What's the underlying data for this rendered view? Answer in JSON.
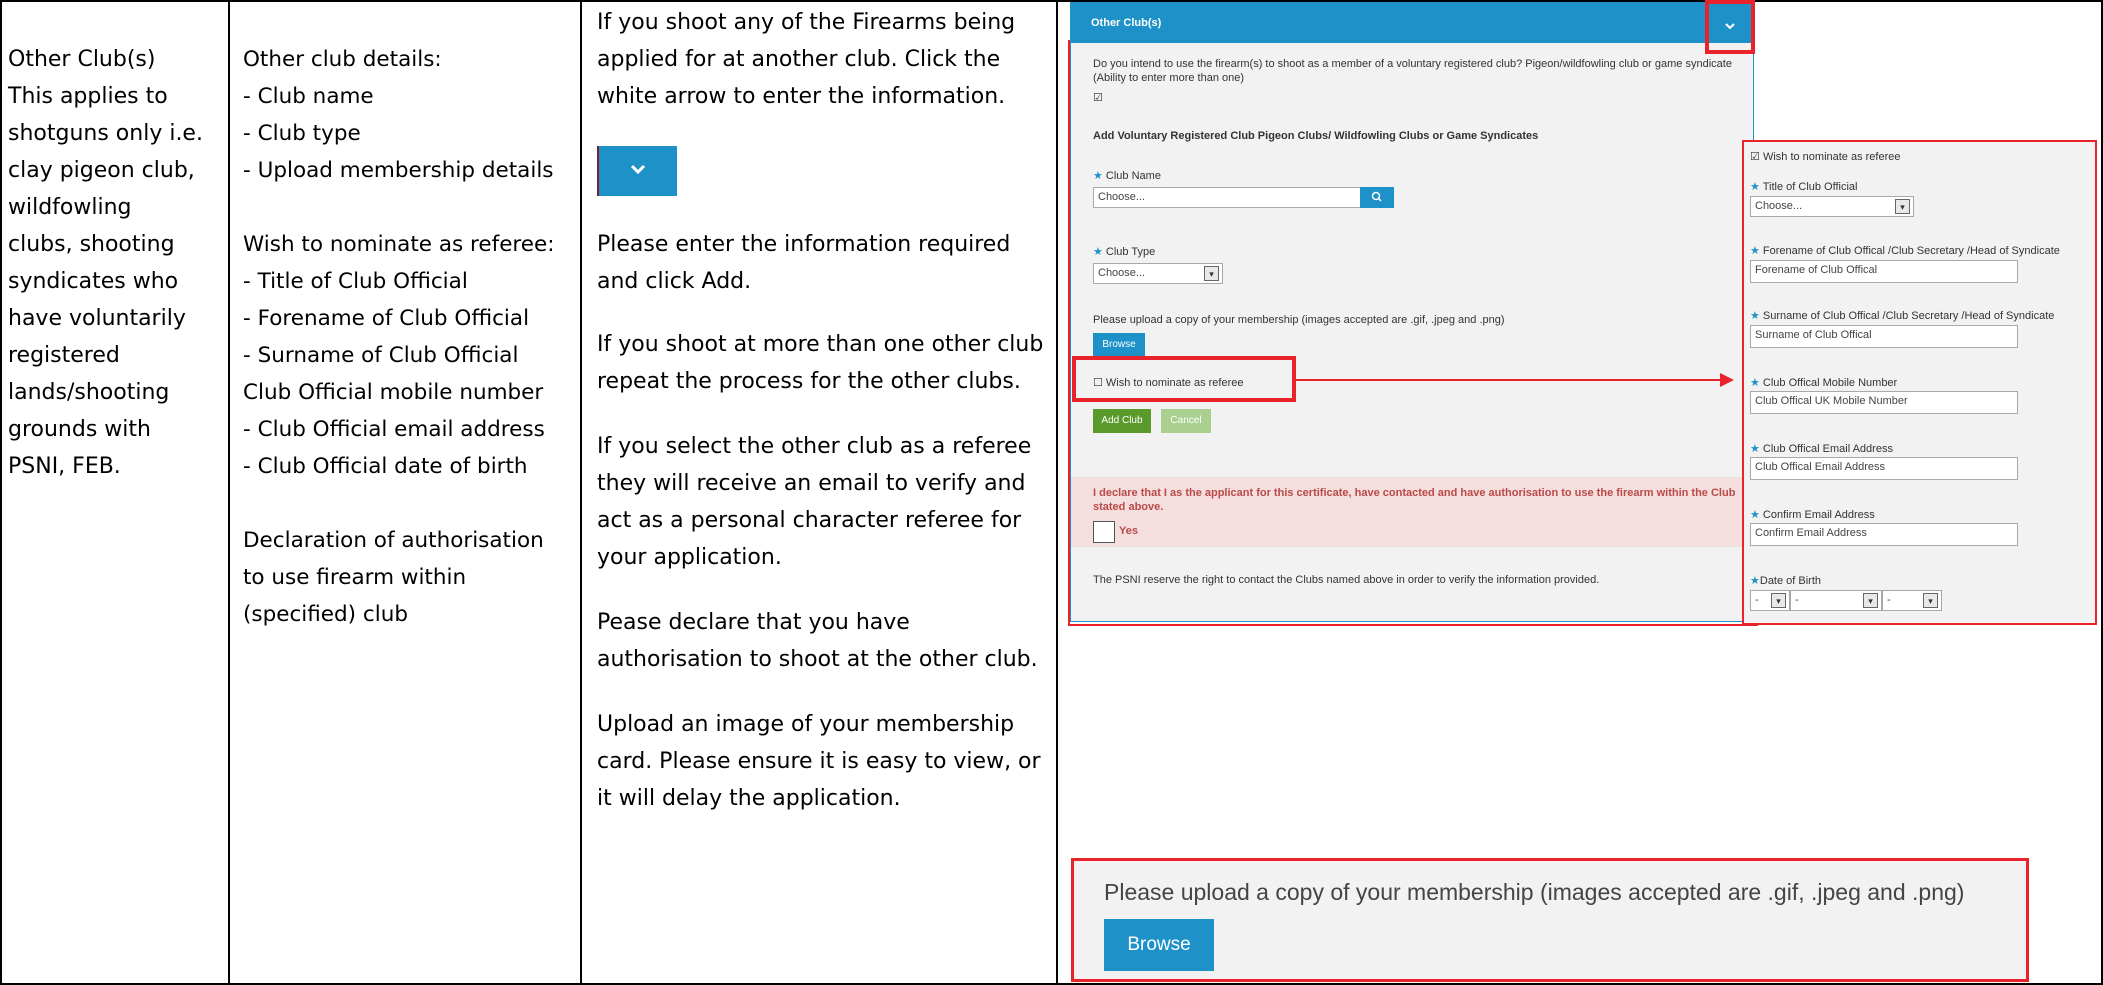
{
  "col1": {
    "lines": [
      "Other Club(s)",
      "This applies to",
      "shotguns only i.e.",
      "clay pigeon club,",
      "wildfowling",
      "clubs, shooting",
      "syndicates who",
      "have voluntarily",
      "registered",
      "lands/shooting",
      "grounds with",
      "PSNI, FEB."
    ]
  },
  "col2": {
    "lines": [
      "Other club details:",
      "- Club name",
      "- Club type",
      "- Upload membership details",
      "",
      "Wish to nominate as referee:",
      "- Title of Club Official",
      "- Forename of Club Official",
      "- Surname of Club Official",
      "Club Official mobile number",
      "- Club Official email address",
      "- Club Official date of birth",
      "",
      "Declaration of authorisation",
      "to use firearm within",
      "(specified) club"
    ]
  },
  "col3": {
    "p1": "If you shoot any of the Firearms being\napplied for at another club. Click the\nwhite arrow to enter the information.",
    "p2": "Please enter the information required\nand click Add.",
    "p3": "If you shoot at more than one other club\nrepeat the process for the other clubs.",
    "p4": "If you select the other club as a referee\nthey will receive an email to verify and\nact as a personal character referee for\nyour application.",
    "p5": "Pease declare that you have\nauthorisation to shoot at the other club.",
    "p6": "Upload an image of your membership\ncard. Please ensure it is easy to view, or\nit will delay the application.",
    "arrow_icon": "chevron-down-icon"
  },
  "form": {
    "header": "Other Club(s)",
    "question": "Do you intend to use the firearm(s) to shoot as a member of a voluntary registered club? Pigeon/wildfowling club or game syndicate (Ability to enter more than one)",
    "check_mark": "☑",
    "section_title": "Add Voluntary Registered Club Pigeon Clubs/ Wildfowling Clubs or Game Syndicates",
    "club_name_label": "Club Name",
    "club_name_placeholder": "Choose...",
    "search_icon": "search-icon",
    "club_type_label": "Club Type",
    "club_type_value": "Choose...",
    "upload_text": "Please upload a copy of your membership (images accepted are .gif, .jpeg and .png)",
    "browse": "Browse",
    "wish_label": "Wish to nominate as referee",
    "add_club": "Add Club",
    "cancel": "Cancel",
    "declare": "I declare that I as the applicant for this certificate, have contacted and have authorisation to use the firearm within the Club stated above.",
    "yes": "Yes",
    "psni_note": "The PSNI reserve the right to contact the Clubs named above in order to verify the information provided."
  },
  "referee": {
    "wish_label": "Wish to nominate as referee",
    "title_label": "Title of Club Official",
    "title_value": "Choose...",
    "forename_label": "Forename of Club Offical /Club Secretary /Head of Syndicate",
    "forename_placeholder": "Forename of Club Offical",
    "surname_label": "Surname of Club Offical /Club Secretary /Head of Syndicate",
    "surname_placeholder": "Surname of Club Offical",
    "mobile_label": "Club Offical Mobile Number",
    "mobile_placeholder": "Club Offical UK Mobile Number",
    "email_label": "Club Offical Email Address",
    "email_placeholder": "Club Offical Email Address",
    "confirm_label": "Confirm Email Address",
    "confirm_placeholder": "Confirm Email Address",
    "dob_label": "Date of Birth",
    "dob_day": "-",
    "dob_month": "-",
    "dob_year": "-"
  },
  "upload_zoom": {
    "text": "Please upload a copy of your membership (images accepted are .gif, .jpeg and .png)",
    "browse": "Browse"
  },
  "colors": {
    "accent": "#1e92c8",
    "highlight": "#e8232b",
    "add_green": "#5a9a2a",
    "declare_red": "#b94a48"
  }
}
